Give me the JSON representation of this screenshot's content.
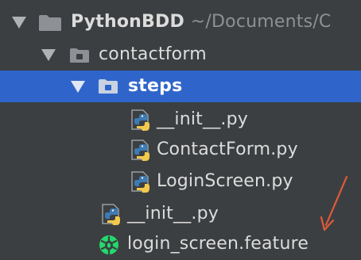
{
  "tree": {
    "project": {
      "name": "PythonBDD",
      "path": "~/Documents/C",
      "icon": "folder-icon"
    },
    "contactform": {
      "name": "contactform",
      "icon": "package-folder-icon"
    },
    "steps": {
      "name": "steps",
      "icon": "package-folder-icon",
      "selected": true
    },
    "steps_files": [
      {
        "name": "__init__.py",
        "icon": "python-file-icon"
      },
      {
        "name": "ContactForm.py",
        "icon": "python-file-icon"
      },
      {
        "name": "LoginScreen.py",
        "icon": "python-file-icon"
      }
    ],
    "contactform_files": [
      {
        "name": "__init__.py",
        "icon": "python-file-icon"
      },
      {
        "name": "login_screen.feature",
        "icon": "cucumber-feature-icon"
      }
    ]
  },
  "colors": {
    "background": "#3c3f41",
    "selection": "#2f65ca",
    "text": "#dcdcdc",
    "path_text": "#8e9093",
    "annotation_arrow": "#e05a3a"
  },
  "annotation": {
    "icon": "red-arrow-icon"
  }
}
